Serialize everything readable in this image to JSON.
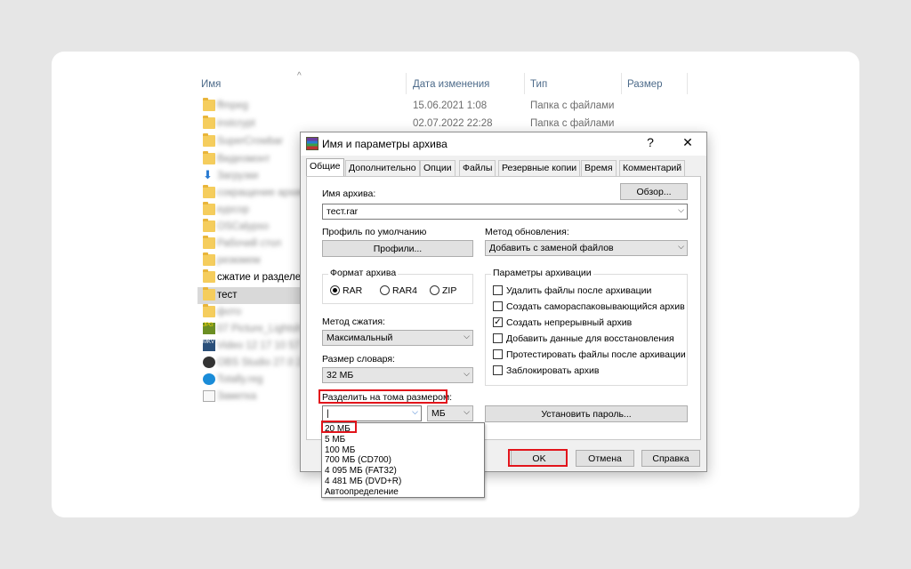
{
  "explorer": {
    "columns": {
      "name": "Имя",
      "date": "Дата изменения",
      "type": "Тип",
      "size": "Размер"
    },
    "sort_icon": "chevron-up-icon",
    "rows": [
      {
        "name": "ffmpeg",
        "date": "15.06.2021 1:08",
        "type": "Папка с файлами",
        "icon": "folder-icon",
        "blurred": true
      },
      {
        "name": "instcrypt",
        "date": "02.07.2022 22:28",
        "type": "Папка с файлами",
        "icon": "folder-icon",
        "blurred": true
      },
      {
        "name": "SuperCrowbar",
        "date": "",
        "type": "",
        "icon": "folder-icon",
        "blurred": true
      },
      {
        "name": "Видеомонт",
        "date": "",
        "type": "",
        "icon": "folder-icon",
        "blurred": true
      },
      {
        "name": "Загрузки",
        "date": "",
        "type": "",
        "icon": "download-arrow-icon",
        "blurred": true
      },
      {
        "name": "сокращение архива",
        "date": "",
        "type": "",
        "icon": "folder-icon",
        "blurred": true
      },
      {
        "name": "курсор",
        "date": "",
        "type": "",
        "icon": "folder-icon",
        "blurred": true
      },
      {
        "name": "OSCalypso",
        "date": "",
        "type": "",
        "icon": "folder-icon",
        "blurred": true
      },
      {
        "name": "Рабочий стол",
        "date": "",
        "type": "",
        "icon": "folder-icon",
        "blurred": true
      },
      {
        "name": "резюмем",
        "date": "",
        "type": "",
        "icon": "folder-icon",
        "blurred": true
      },
      {
        "name": "сжатие и разделен",
        "date": "",
        "type": "",
        "icon": "folder-icon",
        "blurred": false
      },
      {
        "name": "тест",
        "date": "",
        "type": "",
        "icon": "folder-icon",
        "blurred": false,
        "selected": true
      },
      {
        "name": "фото",
        "date": "",
        "type": "",
        "icon": "folder-icon",
        "blurred": true
      },
      {
        "name": "07 Picture_Lightsh",
        "date": "",
        "type": "",
        "icon": "jpg-file-icon",
        "blurred": true
      },
      {
        "name": "Video 12 17 10 57",
        "date": "",
        "type": "",
        "icon": "mkv-file-icon",
        "blurred": true
      },
      {
        "name": "OBS Studio 27.0 22",
        "date": "",
        "type": "",
        "icon": "obs-icon",
        "blurred": true
      },
      {
        "name": "Totally.reg",
        "date": "",
        "type": "",
        "icon": "edge-icon",
        "blurred": true
      },
      {
        "name": "Заметка",
        "date": "",
        "type": "",
        "icon": "text-file-icon",
        "blurred": true
      }
    ]
  },
  "dialog": {
    "title": "Имя и параметры архива",
    "help": "?",
    "close": "✕",
    "tabs": [
      "Общие",
      "Дополнительно",
      "Опции",
      "Файлы",
      "Резервные копии",
      "Время",
      "Комментарий"
    ],
    "archive_name_label": "Имя архива:",
    "browse_button": "Обзор...",
    "archive_name_value": "тест.rar",
    "profile_label": "Профиль по умолчанию",
    "profiles_button": "Профили...",
    "update_method_label": "Метод обновления:",
    "update_method_value": "Добавить с заменой файлов",
    "format_group": "Формат архива",
    "formats": [
      {
        "label": "RAR",
        "checked": true
      },
      {
        "label": "RAR4",
        "checked": false
      },
      {
        "label": "ZIP",
        "checked": false
      }
    ],
    "compression_label": "Метод сжатия:",
    "compression_value": "Максимальный",
    "dict_label": "Размер словаря:",
    "dict_value": "32 МБ",
    "split_label": "Разделить на тома размером:",
    "split_value": "|",
    "split_unit": "МБ",
    "params_group": "Параметры архивации",
    "params": [
      {
        "label": "Удалить файлы после архивации",
        "checked": false
      },
      {
        "label": "Создать самораспаковывающийся архив",
        "checked": false
      },
      {
        "label": "Создать непрерывный архив",
        "checked": true
      },
      {
        "label": "Добавить данные для восстановления",
        "checked": false
      },
      {
        "label": "Протестировать файлы после архивации",
        "checked": false
      },
      {
        "label": "Заблокировать архив",
        "checked": false
      }
    ],
    "password_button": "Установить пароль...",
    "ok_button": "OK",
    "cancel_button": "Отмена",
    "help_button": "Справка",
    "split_options": [
      "20 МБ",
      "5 МБ",
      "100 МБ",
      "700 МБ  (CD700)",
      "4 095 МБ  (FAT32)",
      "4 481 МБ  (DVD+R)",
      "Автоопределение"
    ],
    "highlight_color": "#e2141b"
  }
}
